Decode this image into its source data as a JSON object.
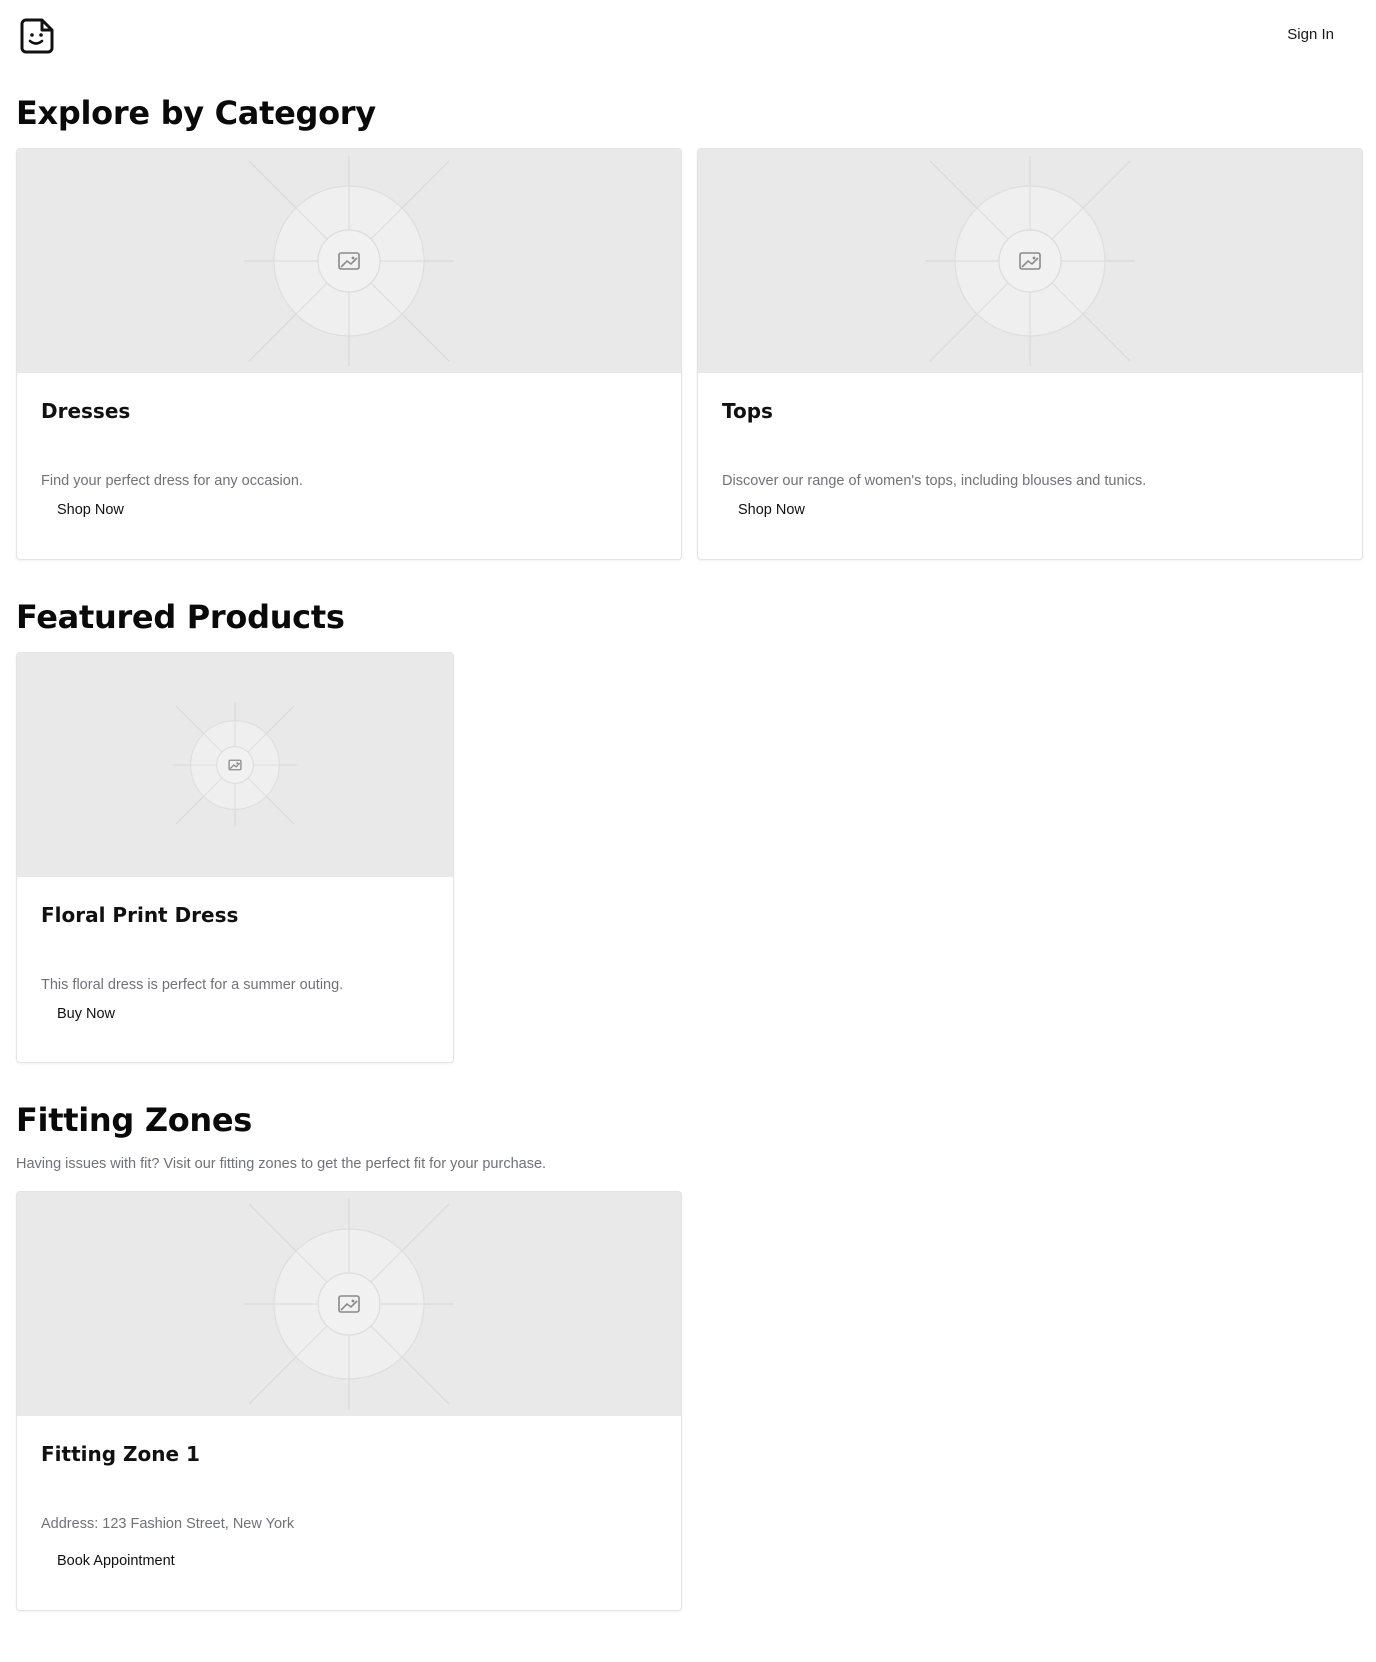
{
  "header": {
    "logo_icon": "smiley-document-icon",
    "sign_in_label": "Sign In"
  },
  "categories": {
    "title": "Explore by Category",
    "items": [
      {
        "title": "Dresses",
        "description": "Find your perfect dress for any occasion.",
        "button_label": "Shop Now",
        "image_icon": "image-placeholder-icon"
      },
      {
        "title": "Tops",
        "description": "Discover our range of women's tops, including blouses and tunics.",
        "button_label": "Shop Now",
        "image_icon": "image-placeholder-icon"
      }
    ]
  },
  "featured": {
    "title": "Featured Products",
    "items": [
      {
        "title": "Floral Print Dress",
        "description": "This floral dress is perfect for a summer outing.",
        "button_label": "Buy Now",
        "image_icon": "image-placeholder-icon"
      }
    ]
  },
  "fitting": {
    "title": "Fitting Zones",
    "subtitle": "Having issues with fit? Visit our fitting zones to get the perfect fit for your purchase.",
    "items": [
      {
        "title": "Fitting Zone 1",
        "description": "Address: 123 Fashion Street, New York",
        "button_label": "Book Appointment",
        "image_icon": "image-placeholder-icon"
      }
    ]
  },
  "colors": {
    "placeholder_bg": "#e9e9e9",
    "muted_text": "#71717a",
    "border": "#e4e4e7"
  }
}
